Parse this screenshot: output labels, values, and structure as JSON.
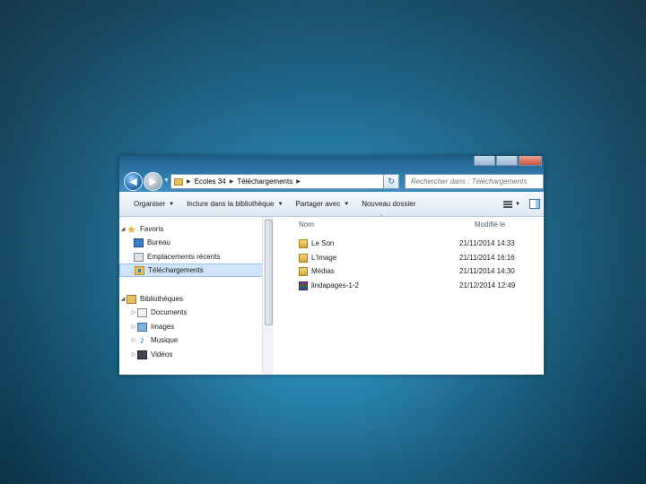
{
  "colors": {
    "accent": "#2c77a8",
    "selection": "#cfe4f8",
    "folder": "#e6c35a"
  },
  "address": {
    "crumbs": [
      "Ecoles 34",
      "Téléchargements"
    ]
  },
  "search": {
    "placeholder": "Rechercher dans : Téléchargements"
  },
  "toolbar": {
    "organize": "Organiser",
    "include_library": "Inclure dans la bibliothèque",
    "share": "Partager avec",
    "new_folder": "Nouveau dossier"
  },
  "nav": {
    "favorites": "Favoris",
    "desktop": "Bureau",
    "recent": "Emplacements récents",
    "downloads": "Téléchargements",
    "libraries": "Bibliothèques",
    "documents": "Documents",
    "images": "Images",
    "music": "Musique",
    "videos": "Vidéos"
  },
  "columns": {
    "name": "Nom",
    "modified": "Modifié le"
  },
  "files": [
    {
      "name": "Le Son",
      "date": "21/11/2014 14:33",
      "icon": "folder-icon"
    },
    {
      "name": "L'Image",
      "date": "21/11/2014 16:16",
      "icon": "folder-icon"
    },
    {
      "name": "Médias",
      "date": "21/11/2014 14:30",
      "icon": "folder-icon"
    },
    {
      "name": "lindapages-1-2",
      "date": "21/12/2014 12:49",
      "icon": "archive-icon"
    }
  ]
}
